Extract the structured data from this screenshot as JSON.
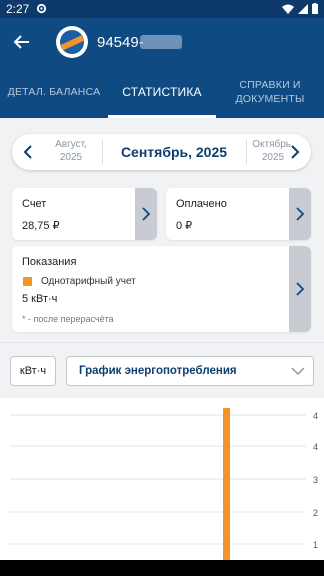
{
  "status_bar": {
    "time": "2:27"
  },
  "header": {
    "account_number": "94549-"
  },
  "tabs": [
    {
      "label": "ДЕТАЛ. БАЛАНСА"
    },
    {
      "label": "СТАТИСТИКА"
    },
    {
      "label": "СПРАВКИ И ДОКУМЕНТЫ"
    }
  ],
  "month_picker": {
    "prev_month": "Август,",
    "prev_year": "2025",
    "current": "Сентябрь, 2025",
    "next_month": "Октябрь,",
    "next_year": "2025"
  },
  "cards": {
    "invoice": {
      "label": "Счет",
      "value": "28,75 ₽"
    },
    "paid": {
      "label": "Оплачено",
      "value": "0 ₽"
    },
    "readings": {
      "label": "Показания",
      "tariff": "Однотарифный учет",
      "value": "5 кВт·ч",
      "note": "* - после перерасчёта"
    }
  },
  "selectors": {
    "unit": "кВт·ч",
    "graph": "График энергопотребления"
  },
  "colors": {
    "primary": "#0f4a83",
    "accent": "#f2932b"
  },
  "chart_data": {
    "type": "bar",
    "y_ticks": [
      "4",
      "4",
      "3",
      "2",
      "1"
    ],
    "bar_color": "#f2932b",
    "grid": true
  }
}
